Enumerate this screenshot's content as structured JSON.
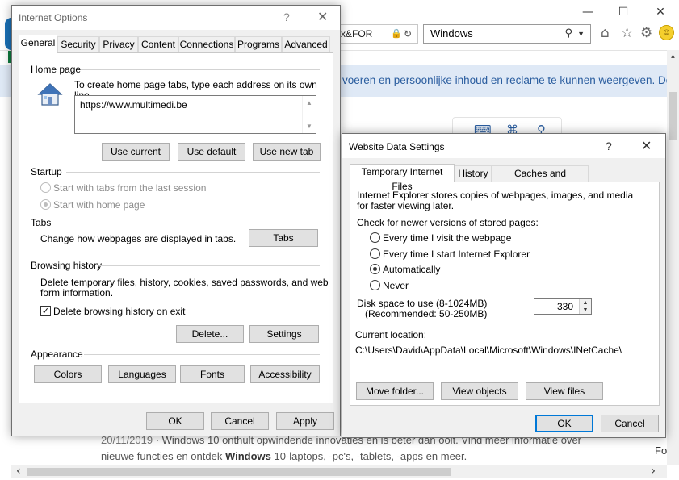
{
  "browser": {
    "address_fragment": "x&FOR",
    "search_value": "Windows",
    "cookie_banner": "voeren en persoonlijke inhoud en reclame te kunnen weergeven. Door",
    "result_date": "20/11/2019",
    "result_line1_a": " · Windows 10 onthult opwindende innovaties en is beter dan ooit. Vind meer informatie over",
    "result_line2_a": "nieuwe functies en ontdek ",
    "result_line2_b": "Windows",
    "result_line2_c": " 10-laptops, -pc's, -tablets, -apps en meer.",
    "right_edge_text": "Fo",
    "icons": [
      "lock-icon",
      "refresh-icon",
      "search-icon",
      "home-icon",
      "favorites-star-icon",
      "settings-gear-icon",
      "smiley-feedback-icon"
    ]
  },
  "internet_options": {
    "title": "Internet Options",
    "help": "?",
    "close": "✕",
    "tabs": [
      "General",
      "Security",
      "Privacy",
      "Content",
      "Connections",
      "Programs",
      "Advanced"
    ],
    "home_page": {
      "heading": "Home page",
      "instruction": "To create home page tabs, type each address on its own line.",
      "url": "https://www.multimedi.be",
      "btn_current": "Use current",
      "btn_default": "Use default",
      "btn_new_tab": "Use new tab"
    },
    "startup": {
      "heading": "Startup",
      "opt1": "Start with tabs from the last session",
      "opt2": "Start with home page"
    },
    "tabs_section": {
      "heading": "Tabs",
      "desc": "Change how webpages are displayed in tabs.",
      "btn": "Tabs"
    },
    "browsing_history": {
      "heading": "Browsing history",
      "desc_line1": "Delete temporary files, history, cookies, saved passwords, and web",
      "desc_line2": "form information.",
      "checkbox": "Delete browsing history on exit",
      "btn_delete": "Delete...",
      "btn_settings": "Settings"
    },
    "appearance": {
      "heading": "Appearance",
      "btn_colors": "Colors",
      "btn_languages": "Languages",
      "btn_fonts": "Fonts",
      "btn_accessibility": "Accessibility"
    },
    "footer": {
      "ok": "OK",
      "cancel": "Cancel",
      "apply": "Apply"
    }
  },
  "website_data": {
    "title": "Website Data Settings",
    "help": "?",
    "close": "✕",
    "tabs": [
      "Temporary Internet Files",
      "History",
      "Caches and databases"
    ],
    "intro_line1": "Internet Explorer stores copies of webpages, images, and media",
    "intro_line2": "for faster viewing later.",
    "check_label": "Check for newer versions of stored pages:",
    "options": [
      "Every time I visit the webpage",
      "Every time I start Internet Explorer",
      "Automatically",
      "Never"
    ],
    "disk_label1": "Disk space to use (8-1024MB)",
    "disk_label2": "(Recommended: 50-250MB)",
    "disk_value": "330",
    "location_label": "Current location:",
    "location_path": "C:\\Users\\David\\AppData\\Local\\Microsoft\\Windows\\INetCache\\",
    "btn_move": "Move folder...",
    "btn_objects": "View objects",
    "btn_files": "View files",
    "ok": "OK",
    "cancel": "Cancel"
  }
}
